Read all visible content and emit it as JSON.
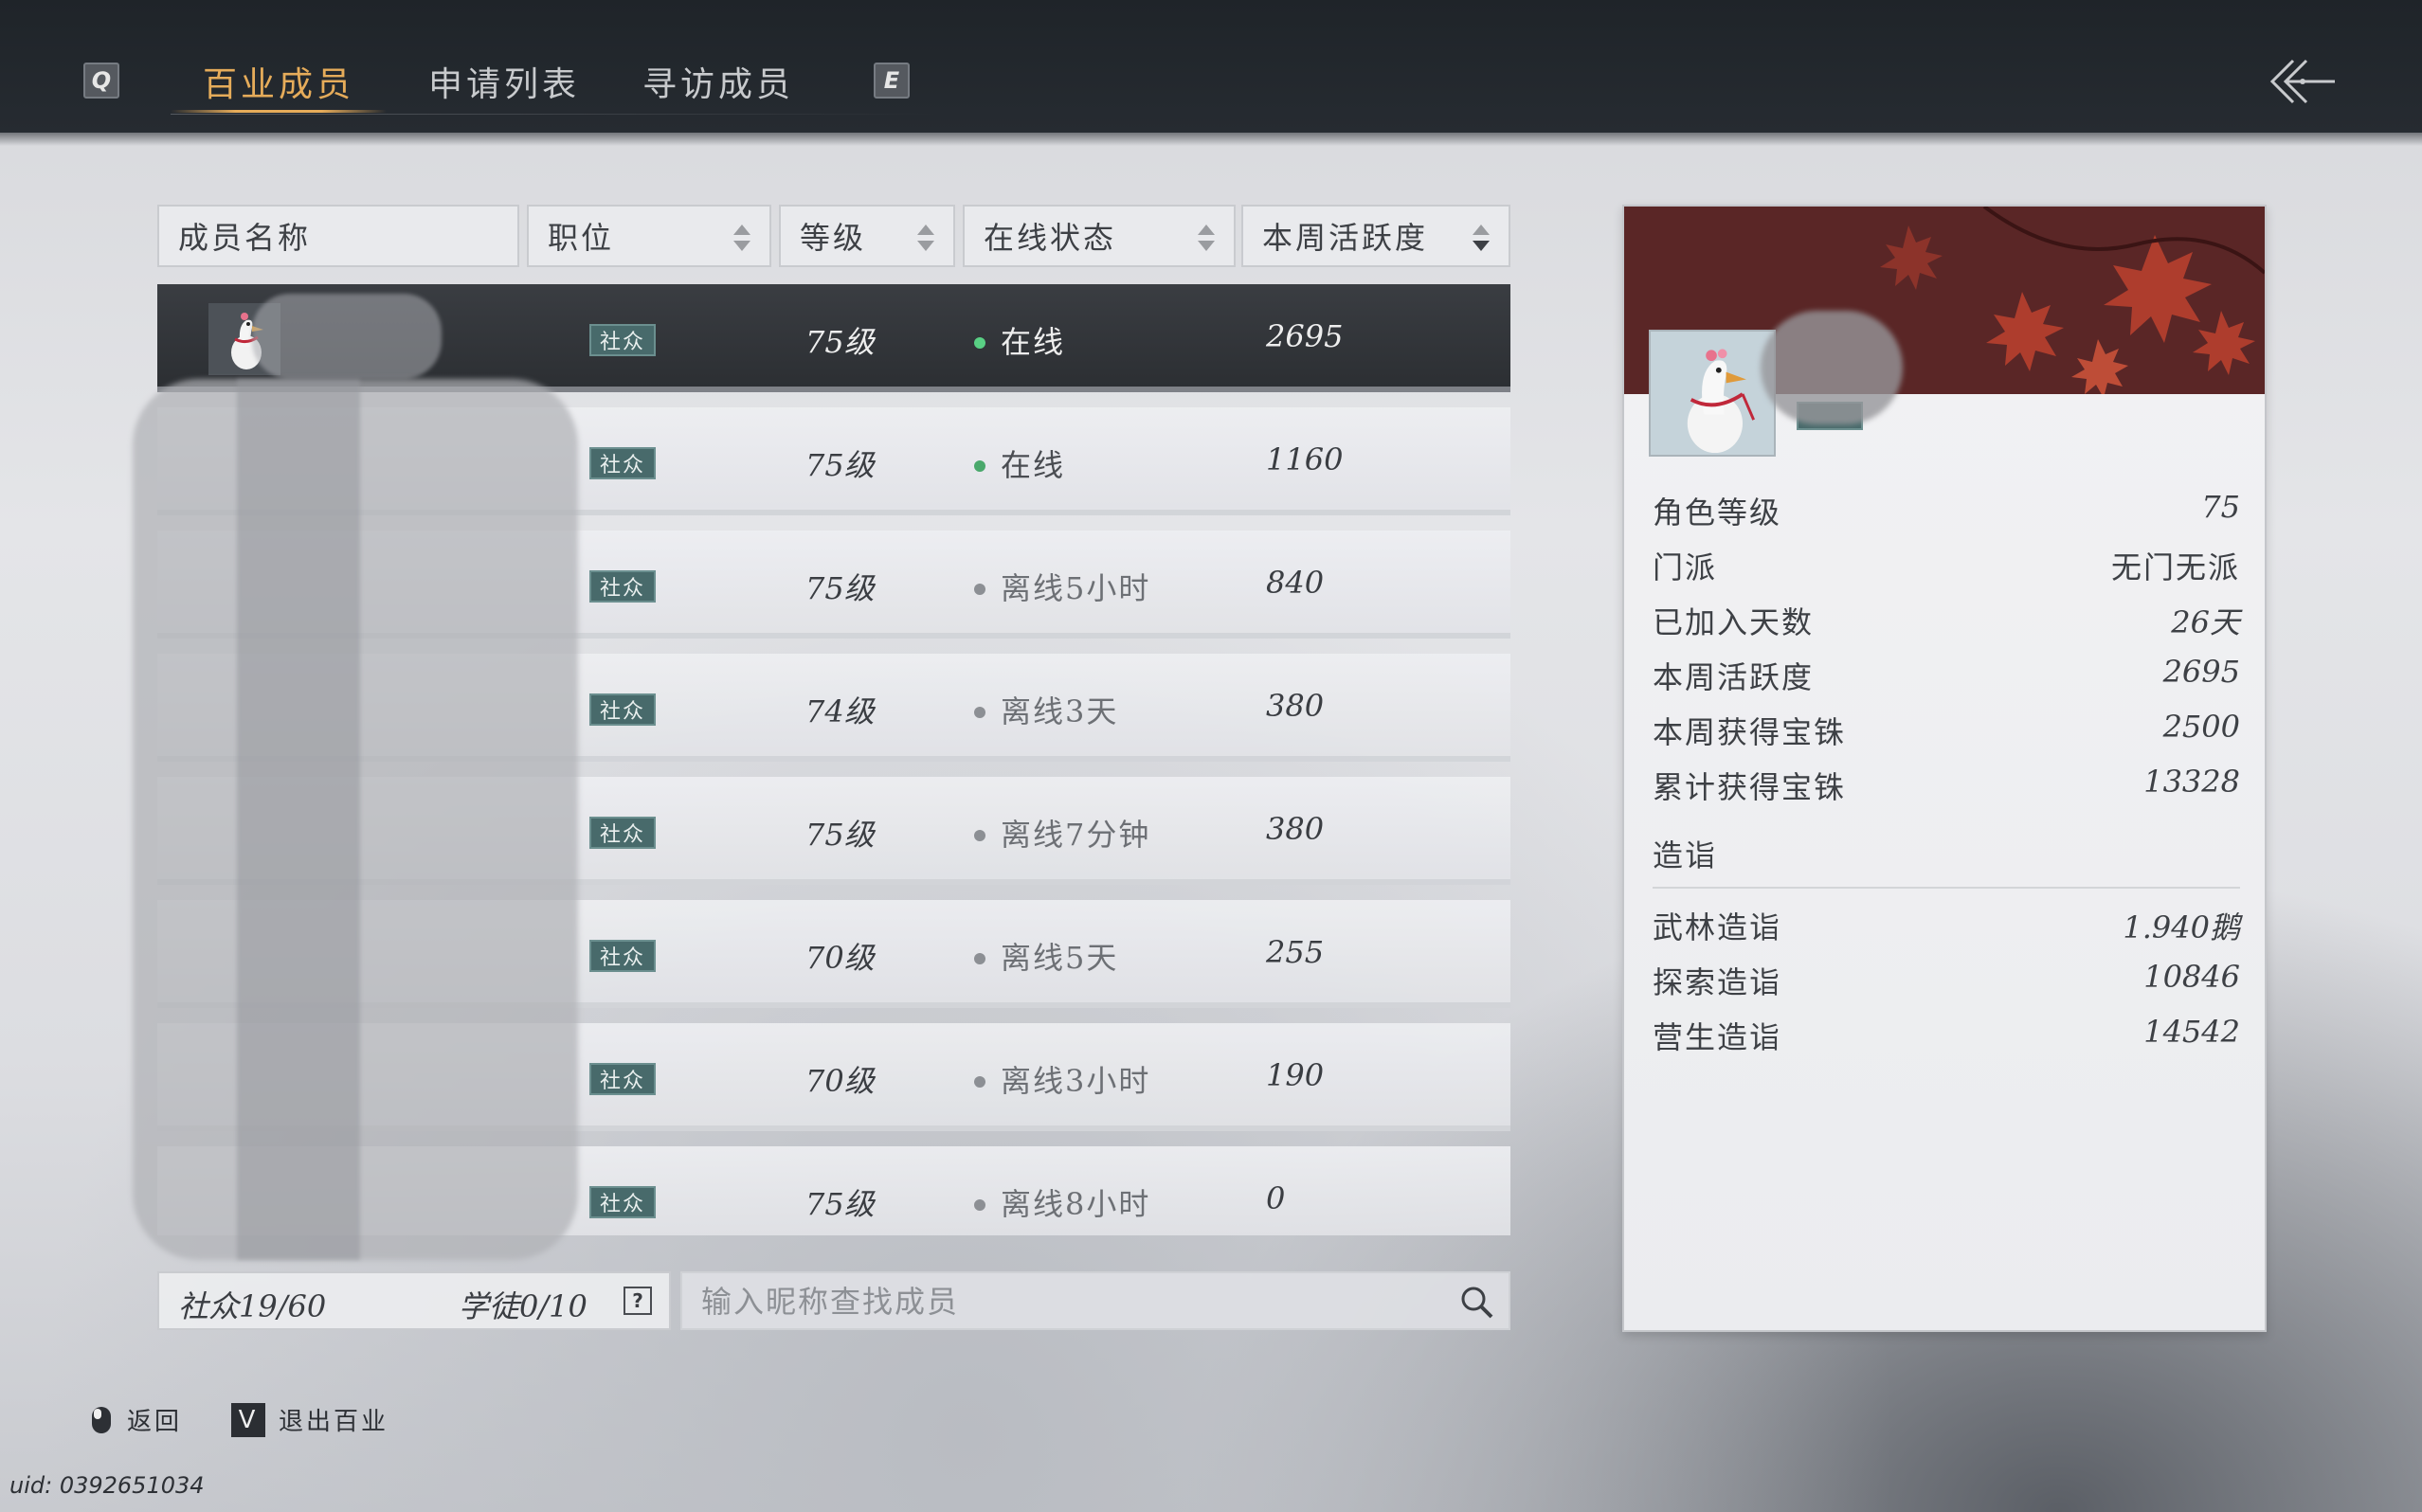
{
  "tabs": {
    "left_key": "Q",
    "right_key": "E",
    "items": [
      "百业成员",
      "申请列表",
      "寻访成员"
    ]
  },
  "columns": {
    "name": "成员名称",
    "position": "职位",
    "level": "等级",
    "status": "在线状态",
    "activity": "本周活跃度"
  },
  "members": [
    {
      "rank": "社众",
      "level": "75级",
      "status": "在线",
      "online": true,
      "activity": "2695"
    },
    {
      "rank": "社众",
      "level": "75级",
      "status": "在线",
      "online": true,
      "activity": "1160"
    },
    {
      "rank": "社众",
      "level": "75级",
      "status": "离线5小时",
      "online": false,
      "activity": "840"
    },
    {
      "rank": "社众",
      "level": "74级",
      "status": "离线3天",
      "online": false,
      "activity": "380"
    },
    {
      "rank": "社众",
      "level": "75级",
      "status": "离线7分钟",
      "online": false,
      "activity": "380"
    },
    {
      "rank": "社众",
      "level": "70级",
      "status": "离线5天",
      "online": false,
      "activity": "255"
    },
    {
      "rank": "社众",
      "level": "70级",
      "status": "离线3小时",
      "online": false,
      "activity": "190"
    },
    {
      "rank": "社众",
      "level": "75级",
      "status": "离线8小时",
      "online": false,
      "activity": "0"
    }
  ],
  "counts": {
    "members": "社众19/60",
    "apprentices": "学徒0/10",
    "help": "?"
  },
  "search": {
    "placeholder": "输入昵称查找成员"
  },
  "details": {
    "stats": [
      {
        "label": "角色等级",
        "value": "75"
      },
      {
        "label": "门派",
        "value": "无门无派"
      },
      {
        "label": "已加入天数",
        "value": "26天"
      },
      {
        "label": "本周活跃度",
        "value": "2695"
      },
      {
        "label": "本周获得宝铢",
        "value": "2500"
      },
      {
        "label": "累计获得宝铢",
        "value": "13328"
      }
    ],
    "section_title": "造诣",
    "skills": [
      {
        "label": "武林造诣",
        "value": "1.940鹅"
      },
      {
        "label": "探索造诣",
        "value": "10846"
      },
      {
        "label": "营生造诣",
        "value": "14542"
      }
    ]
  },
  "footer": {
    "back": "返回",
    "exit_key": "V",
    "exit": "退出百业",
    "uid": "uid: 0392651034"
  },
  "colors": {
    "accent": "#e6ac5a",
    "online": "#49a86b",
    "badge": "#486a6b"
  }
}
